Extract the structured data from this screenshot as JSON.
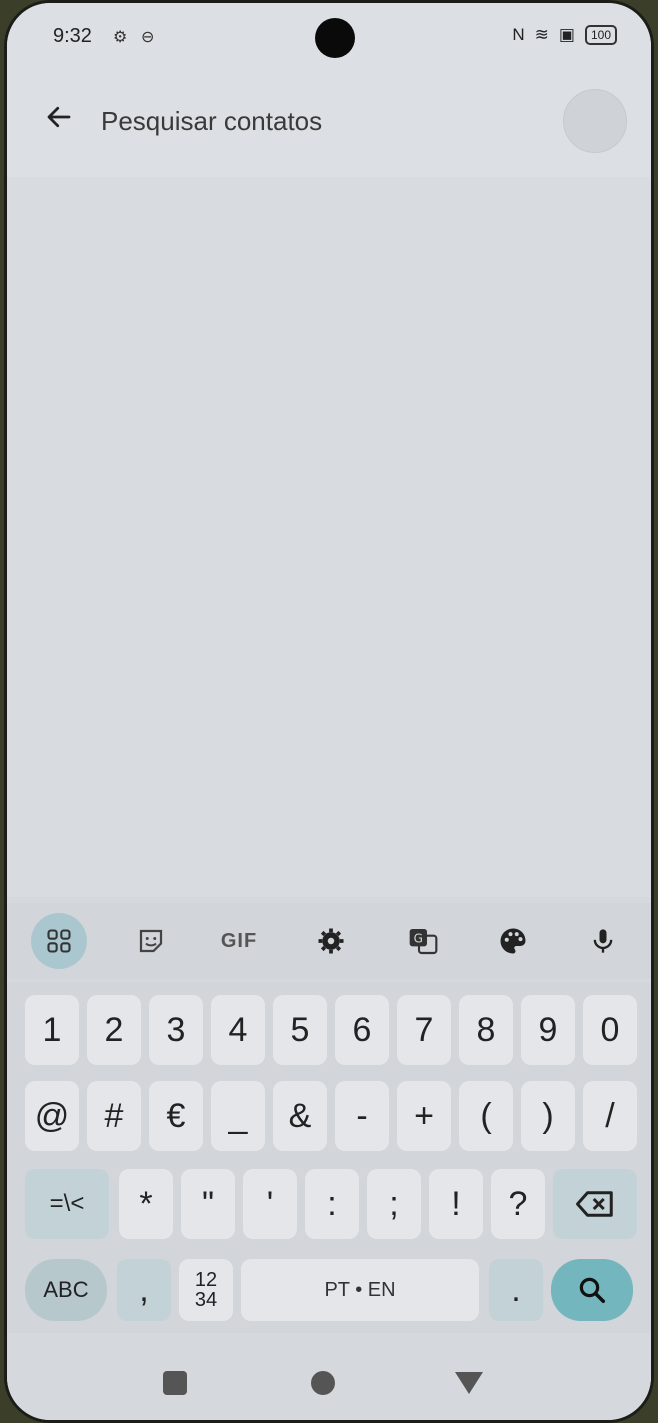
{
  "status": {
    "time": "9:32",
    "battery": "100"
  },
  "search": {
    "placeholder": "Pesquisar contatos"
  },
  "toolbar": {
    "gif_label": "GIF"
  },
  "keyboard": {
    "row1": [
      "1",
      "2",
      "3",
      "4",
      "5",
      "6",
      "7",
      "8",
      "9",
      "0"
    ],
    "row2": [
      "@",
      "#",
      "€",
      "_",
      "&",
      "-",
      "+",
      "(",
      ")",
      "/"
    ],
    "row3_shift": "=\\<",
    "row3": [
      "*",
      "\"",
      "'",
      ":",
      ";",
      "!",
      "?"
    ],
    "abc_label": "ABC",
    "comma": ",",
    "numpad_top": "12",
    "numpad_bottom": "34",
    "space_label": "PT • EN",
    "period": "."
  }
}
